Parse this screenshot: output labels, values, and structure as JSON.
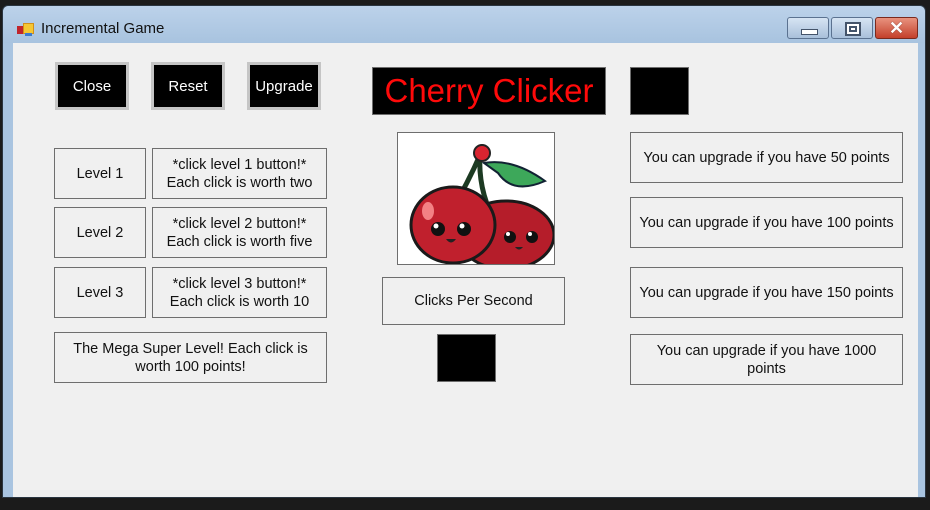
{
  "window": {
    "title": "Incremental Game",
    "controls": {
      "minimize": "minimize",
      "maximize": "maximize",
      "close": "close"
    }
  },
  "toolbar": {
    "close_label": "Close",
    "reset_label": "Reset",
    "upgrade_label": "Upgrade"
  },
  "header": {
    "title": "Cherry Clicker",
    "title_color": "#ff0a0a",
    "score_display": ""
  },
  "levels": [
    {
      "button": "Level 1",
      "desc_line1": "*click level 1 button!*",
      "desc_line2": "Each click is worth two"
    },
    {
      "button": "Level 2",
      "desc_line1": "*click level 2 button!*",
      "desc_line2": "Each click is worth five"
    },
    {
      "button": "Level 3",
      "desc_line1": "*click level 3 button!*",
      "desc_line2": "Each click is worth 10"
    }
  ],
  "mega_level": {
    "label": "The Mega Super Level! Each click is worth 100 points!"
  },
  "center": {
    "image_alt": "cherry-image",
    "cps_label": "Clicks Per Second",
    "cps_value": ""
  },
  "upgrades": [
    "You can upgrade if you have 50 points",
    "You can upgrade if you have 100 points",
    "You can upgrade if you have 150 points",
    "You can upgrade if you have 1000 points"
  ]
}
